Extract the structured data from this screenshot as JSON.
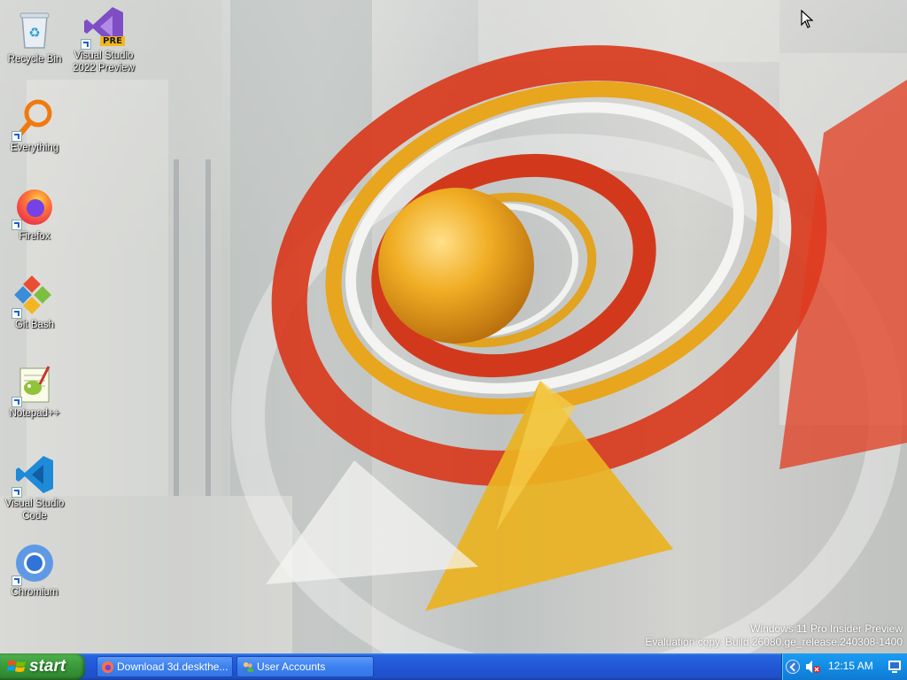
{
  "desktop": {
    "icons": [
      {
        "label": "Recycle Bin",
        "icon": "recycle-bin-icon"
      },
      {
        "label": "Visual Studio 2022 Preview",
        "icon": "visual-studio-icon",
        "badge": "PRE"
      },
      {
        "label": "Everything",
        "icon": "everything-search-icon"
      },
      {
        "label": "Firefox",
        "icon": "firefox-icon"
      },
      {
        "label": "Git Bash",
        "icon": "git-bash-icon"
      },
      {
        "label": "Notepad++",
        "icon": "notepad-plus-plus-icon"
      },
      {
        "label": "Visual Studio Code",
        "icon": "vscode-icon"
      },
      {
        "label": "Chromium",
        "icon": "chromium-icon"
      }
    ]
  },
  "watermark": {
    "line1": "Windows 11 Pro Insider Preview",
    "line2": "Evaluation copy. Build 26080.ge_release.240308-1400"
  },
  "taskbar": {
    "start_label": "start",
    "tasks": [
      {
        "label": "Download 3d.deskthe...",
        "icon": "firefox-icon"
      },
      {
        "label": "User Accounts",
        "icon": "user-accounts-icon"
      }
    ],
    "tray": {
      "clock": "12:15 AM",
      "icons": [
        "show-hidden-icons-chevron",
        "volume-muted-icon",
        "system-icon"
      ]
    }
  },
  "colors": {
    "taskbar_blue": "#2257d6",
    "start_green": "#3a9b3a",
    "tray_blue": "#138ce4",
    "wallpaper_red": "#d8361a",
    "wallpaper_gold": "#e8a51e"
  }
}
